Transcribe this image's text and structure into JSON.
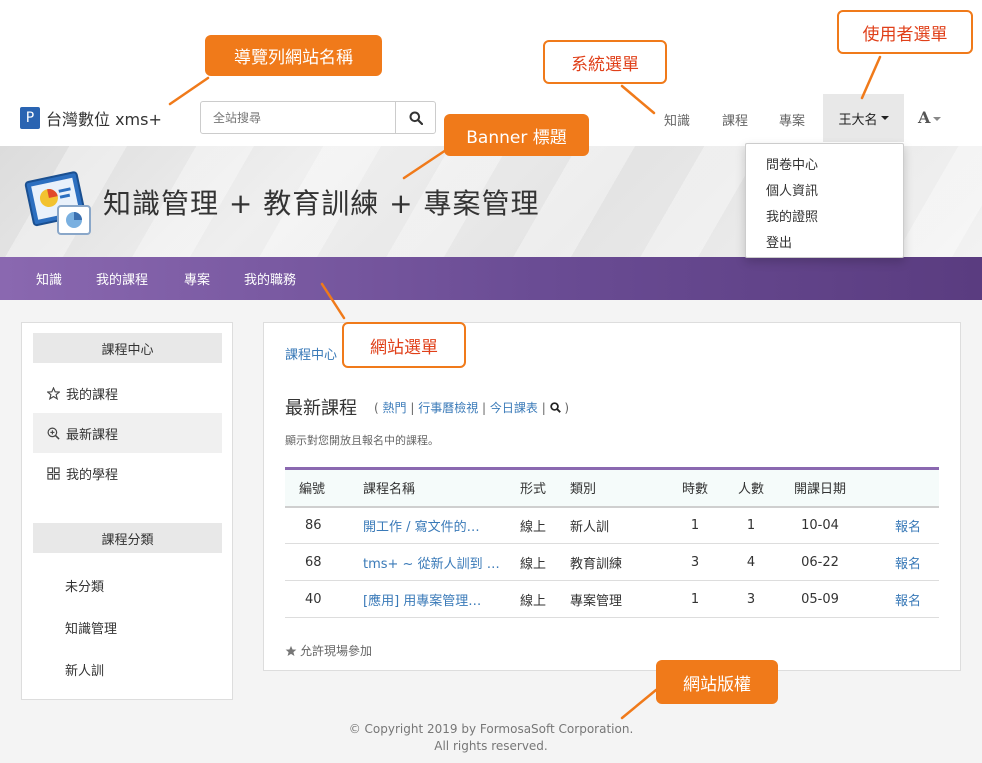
{
  "navbar": {
    "brand_logo": "P",
    "brand_name": "台灣數位 xms+",
    "search_placeholder": "全站搜尋",
    "system_menu": [
      "知識",
      "課程",
      "專案"
    ],
    "user_name": "王大名",
    "font_menu": "A"
  },
  "user_dropdown": [
    "問卷中心",
    "個人資訊",
    "我的證照",
    "登出"
  ],
  "banner": {
    "title": "知識管理 + 教育訓練 + 專案管理"
  },
  "site_menu": [
    "知識",
    "我的課程",
    "專案",
    "我的職務"
  ],
  "sidebar": {
    "course_center_title": "課程中心",
    "course_items": [
      "我的課程",
      "最新課程",
      "我的學程"
    ],
    "category_title": "課程分類",
    "categories": [
      "未分類",
      "知識管理",
      "新人訓"
    ]
  },
  "main": {
    "breadcrumb": "課程中心",
    "title": "最新課程",
    "links": [
      "熱門",
      "行事曆檢視",
      "今日課表"
    ],
    "description": "顯示對您開放且報名中的課程。",
    "table": {
      "headers": [
        "編號",
        "課程名稱",
        "形式",
        "類別",
        "時數",
        "人數",
        "開課日期"
      ],
      "rows": [
        {
          "id": "86",
          "name": "開工作 / 寫文件的…",
          "format": "線上",
          "category": "新人訓",
          "hours": "1",
          "people": "1",
          "date": "10-04",
          "action": "報名"
        },
        {
          "id": "68",
          "name": "tms+ ~ 從新人訓到 …",
          "format": "線上",
          "category": "教育訓練",
          "hours": "3",
          "people": "4",
          "date": "06-22",
          "action": "報名"
        },
        {
          "id": "40",
          "name": "[應用] 用專案管理…",
          "format": "線上",
          "category": "專案管理",
          "hours": "1",
          "people": "3",
          "date": "05-09",
          "action": "報名"
        }
      ]
    },
    "footnote": "允許現場參加"
  },
  "footer": {
    "copyright_line1": "© Copyright 2019 by FormosaSoft Corporation.",
    "copyright_line2": "All rights reserved."
  },
  "callouts": {
    "navbar_site_name": "導覽列網站名稱",
    "system_menu": "系統選單",
    "user_menu": "使用者選單",
    "banner_title": "Banner 標題",
    "site_menu": "網站選單",
    "site_copyright": "網站版權"
  },
  "colors": {
    "accent_orange": "#f07a1a",
    "menu_purple": "#6a4c94",
    "link_blue": "#3a7ab8",
    "brand_blue": "#2a64b2"
  }
}
